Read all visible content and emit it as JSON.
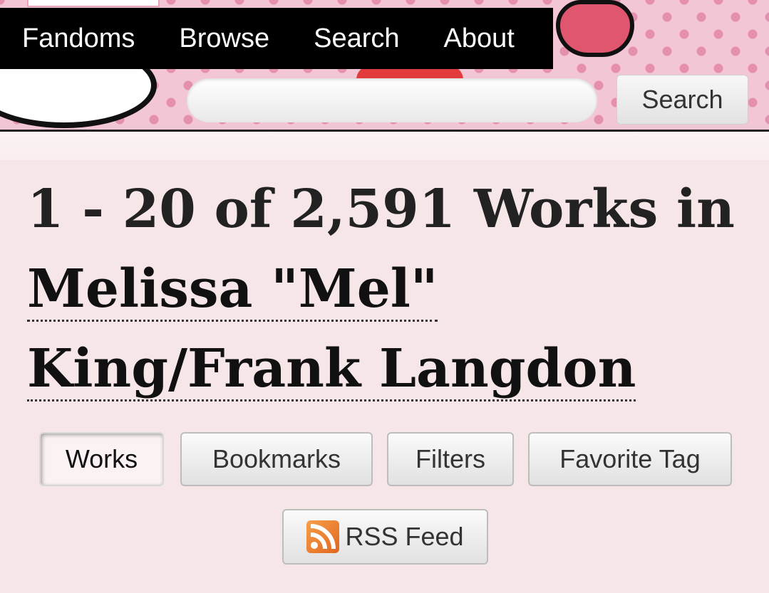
{
  "nav": {
    "items": [
      {
        "label": "Fandoms"
      },
      {
        "label": "Browse"
      },
      {
        "label": "Search"
      },
      {
        "label": "About"
      }
    ]
  },
  "search": {
    "value": "",
    "placeholder": "",
    "button_label": "Search"
  },
  "heading": {
    "prefix": "1 - 20 of 2,591 Works in",
    "tag_line1": "Melissa \"Mel\"",
    "tag_line2": "King/Frank Langdon"
  },
  "actions": {
    "works": "Works",
    "bookmarks": "Bookmarks",
    "filters": "Filters",
    "favorite_tag": "Favorite Tag",
    "rss_feed": "RSS Feed",
    "current": "works"
  },
  "icons": {
    "rss": "rss-feed-icon"
  },
  "colors": {
    "nav_bg": "#000000",
    "page_bg": "#f6e6e8",
    "rss_orange": "#e0661f"
  }
}
